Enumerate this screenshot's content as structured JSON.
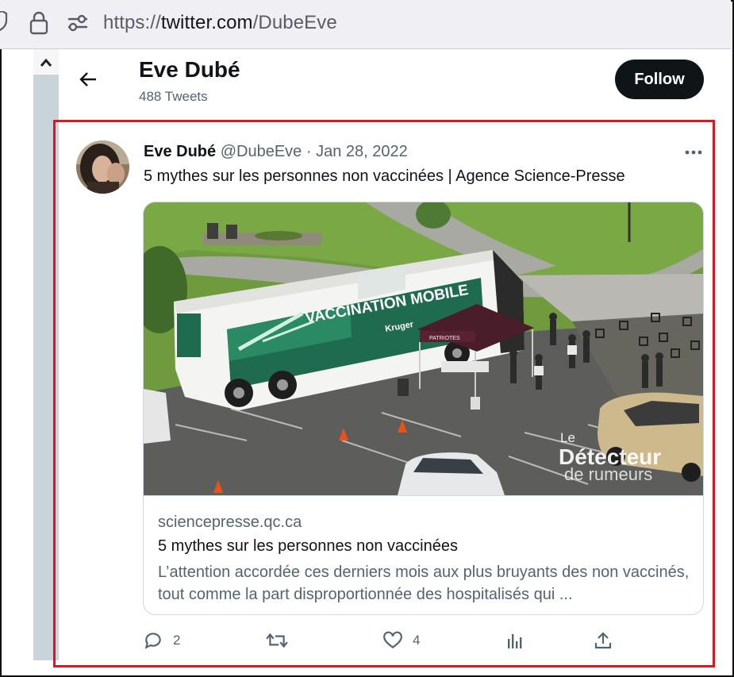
{
  "browser": {
    "url_prefix": "https://",
    "url_host": "twitter.com",
    "url_path": "/DubeEve"
  },
  "header": {
    "profile_name": "Eve Dubé",
    "tweet_count": "488 Tweets",
    "follow_label": "Follow"
  },
  "tweet": {
    "author_name": "Eve Dubé",
    "author_meta": "@DubeEve · Jan 28, 2022",
    "text": "5 mythes sur les personnes non vaccinées | Agence Science-Presse",
    "card": {
      "bus_text": "VACCINATION MOBILE",
      "bus_brand": "Kruger",
      "tent_text": "PATRIOTES",
      "watermark_line1": "Le",
      "watermark_line2": "Détecteur",
      "watermark_line3": "de rumeurs",
      "domain": "sciencepresse.qc.ca",
      "title": "5 mythes sur les personnes non vaccinées",
      "description": "L’attention accordée ces derniers mois aux plus bruyants des non vaccinés, tout comme la part disproportionnée des hospitalisés qui ..."
    },
    "actions": {
      "reply_count": "2",
      "retweet_count": "",
      "like_count": "4"
    }
  },
  "colors": {
    "highlight": "#e0141e",
    "text_primary": "#0f1419",
    "text_secondary": "#536471"
  }
}
